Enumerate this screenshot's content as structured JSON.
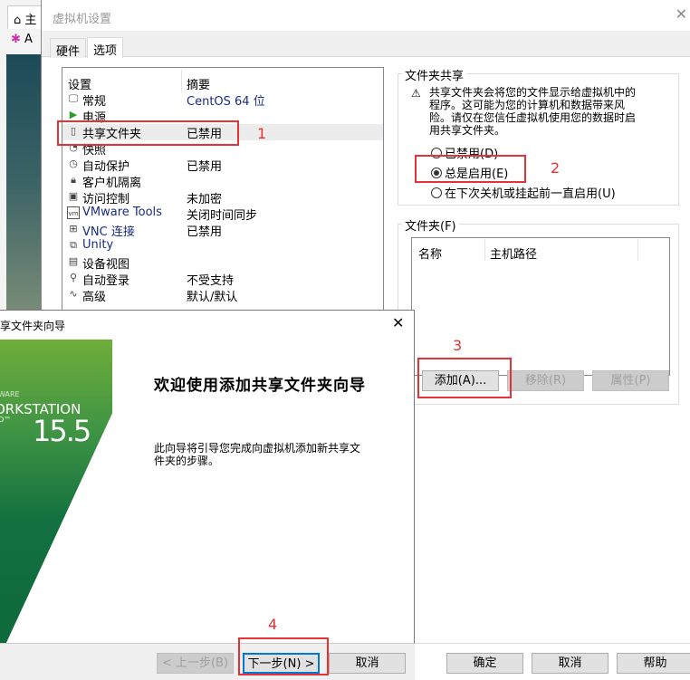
{
  "background_window": {
    "home_tab": "主",
    "toolbar_letter": "A"
  },
  "settings": {
    "title": "虚拟机设置",
    "tabs": [
      {
        "label": "硬件"
      },
      {
        "label": "选项"
      }
    ],
    "list": {
      "col_setting": "设置",
      "col_summary": "摘要",
      "rows": [
        {
          "name": "常规",
          "summary": "CentOS 64 位",
          "icon": "monitor-icon"
        },
        {
          "name": "电源",
          "summary": "",
          "icon": "play-icon"
        },
        {
          "name": "共享文件夹",
          "summary": "已禁用",
          "icon": "shared-folder-icon"
        },
        {
          "name": "快照",
          "summary": "",
          "icon": "snapshot-icon"
        },
        {
          "name": "自动保护",
          "summary": "已禁用",
          "icon": "clock-icon"
        },
        {
          "name": "客户机隔离",
          "summary": "",
          "icon": "lock-icon"
        },
        {
          "name": "访问控制",
          "summary": "未加密",
          "icon": "access-control-icon"
        },
        {
          "name": "VMware Tools",
          "summary": "关闭时间同步",
          "icon": "vm-icon"
        },
        {
          "name": "VNC 连接",
          "summary": "已禁用",
          "icon": "vnc-icon"
        },
        {
          "name": "Unity",
          "summary": "",
          "icon": "unity-icon"
        },
        {
          "name": "设备视图",
          "summary": "",
          "icon": "device-view-icon"
        },
        {
          "name": "自动登录",
          "summary": "不受支持",
          "icon": "users-icon"
        },
        {
          "name": "高级",
          "summary": "默认/默认",
          "icon": "advanced-icon"
        }
      ]
    },
    "sharing": {
      "label": "文件夹共享",
      "warning": "共享文件夹会将您的文件显示给虚拟机中的程序。这可能为您的计算机和数据带来风险。请仅在您信任虚拟机使用您的数据时启用共享文件夹。",
      "options": [
        {
          "label": "已禁用(D)",
          "checked": false
        },
        {
          "label": "总是启用(E)",
          "checked": true
        },
        {
          "label": "在下次关机或挂起前一直启用(U)",
          "checked": false
        }
      ]
    },
    "folders": {
      "label": "文件夹(F)",
      "col_name": "名称",
      "col_path": "主机路径",
      "add": "添加(A)...",
      "remove": "移除(R)",
      "properties": "属性(P)"
    },
    "buttons": {
      "ok": "确定",
      "cancel": "取消",
      "help": "帮助"
    }
  },
  "annotations": [
    "1",
    "2",
    "3",
    "4"
  ],
  "annotation_color": "#e63232",
  "wizard": {
    "title": "共享文件夹向导",
    "banner": {
      "brand": "WARE",
      "product": "ORKSTATION",
      "edition": "O™",
      "version": "15.5"
    },
    "heading": "欢迎使用添加共享文件夹向导",
    "description": "此向导将引导您完成向虚拟机添加新共享文件夹的步骤。",
    "buttons": {
      "back": "< 上一步(B)",
      "next": "下一步(N) >",
      "cancel": "取消"
    }
  }
}
